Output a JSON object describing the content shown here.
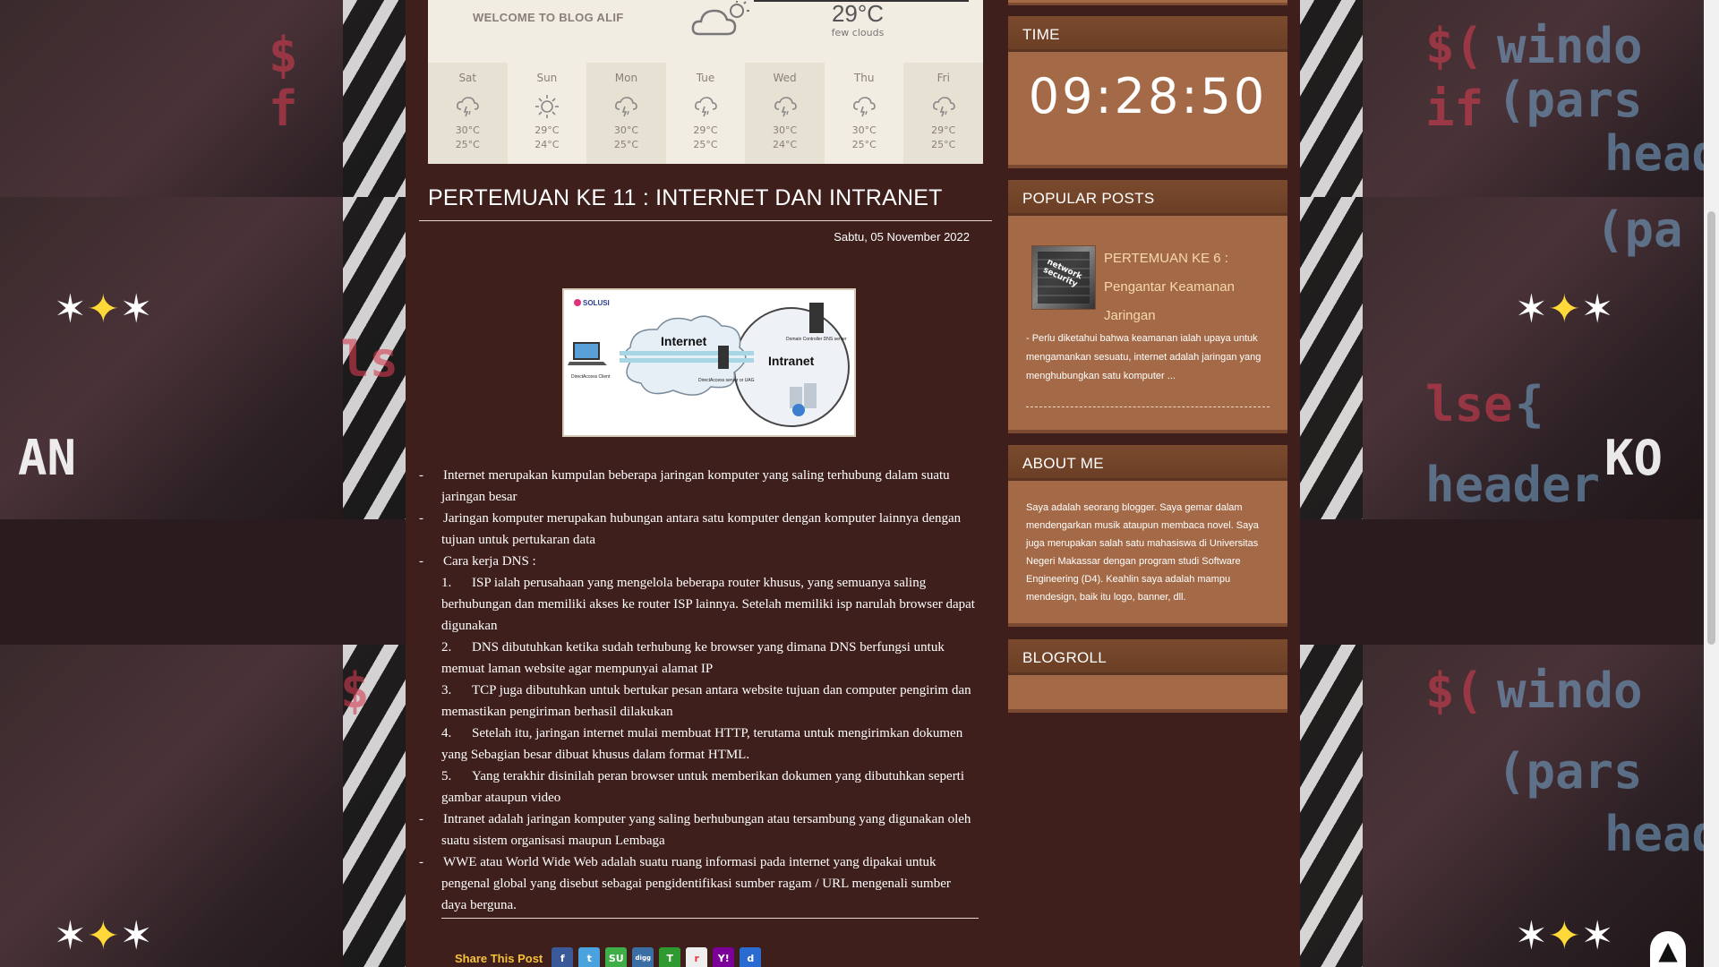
{
  "weather": {
    "welcome": "WELCOME TO BLOG ALIF",
    "current_temp": "29°C",
    "current_condition": "few clouds",
    "days": [
      {
        "name": "Sat",
        "icon": "rain-cloud-icon",
        "hi": "30°C",
        "lo": "25°C"
      },
      {
        "name": "Sun",
        "icon": "sun-icon",
        "hi": "29°C",
        "lo": "24°C"
      },
      {
        "name": "Mon",
        "icon": "rain-cloud-icon",
        "hi": "30°C",
        "lo": "25°C"
      },
      {
        "name": "Tue",
        "icon": "rain-cloud-icon",
        "hi": "29°C",
        "lo": "25°C"
      },
      {
        "name": "Wed",
        "icon": "rain-cloud-icon",
        "hi": "30°C",
        "lo": "24°C"
      },
      {
        "name": "Thu",
        "icon": "rain-cloud-icon",
        "hi": "30°C",
        "lo": "25°C"
      },
      {
        "name": "Fri",
        "icon": "rain-cloud-icon",
        "hi": "29°C",
        "lo": "25°C"
      }
    ]
  },
  "post": {
    "title": "PERTEMUAN KE 11 : INTERNET DAN INTRANET",
    "date": "Sabtu, 05 November 2022",
    "image_labels": {
      "brand": "SOLUSI",
      "internet": "Internet",
      "intranet": "Intranet",
      "client": "DirectAccess Client",
      "server": "DirectAccess server or UAG",
      "dc": "Domain Controller DNS server"
    },
    "bullet_1": "Internet merupakan kumpulan beberapa jaringan komputer  yang saling terhubung dalam suatu jaringan besar",
    "bullet_2": "Jaringan komputer merupakan hubungan antara satu komputer dengan komputer lainnya dengan tujuan untuk pertukaran data",
    "bullet_3": "Cara kerja DNS :",
    "steps": [
      {
        "num": "1.",
        "text": "ISP ialah perusahaan yang mengelola beberapa router khusus, yang semuanya saling berhubungan dan memiliki akses ke router ISP lainnya. Setelah memiliki isp narulah browser dapat digunakan"
      },
      {
        "num": "2.",
        "text": "DNS dibutuhkan ketika sudah terhubung ke browser yang dimana DNS berfungsi untuk memuat laman website agar mempunyai alamat IP"
      },
      {
        "num": "3.",
        "text": "TCP juga dibutuhkan untuk bertukar pesan antara website tujuan dan computer pengirim dan memastikan pengiriman berhasil dilakukan"
      },
      {
        "num": "4.",
        "text": "Setelah itu, jaringan internet mulai membuat  HTTP, terutama untuk mengirimkan dokumen yang Sebagian besar dibuat khusus dalam format HTML."
      },
      {
        "num": "5.",
        "text": "Yang terakhir disinilah peran browser untuk memberikan dokumen yang dibutuhkan seperti gambar ataupun video"
      }
    ],
    "bullet_4": "Intranet adalah jaringan komputer yang saling berhubungan atau tersambung yang digunakan oleh suatu sistem organisasi maupun Lembaga",
    "bullet_5": "WWE atau World Wide Web adalah suatu ruang informasi pada internet yang dipakai untuk pengenal global yang disebut sebagai pengidentifikasi sumber ragam / URL mengenali sumber daya berguna.",
    "dash": "-",
    "share_label": "Share This Post"
  },
  "share_buttons": [
    {
      "icon": "facebook-icon",
      "glyph": "f",
      "color": "#3b5998"
    },
    {
      "icon": "twitter-icon",
      "glyph": "t",
      "color": "#4aa3df"
    },
    {
      "icon": "stumbleupon-icon",
      "glyph": "SU",
      "color": "#3fae49"
    },
    {
      "icon": "digg-icon",
      "glyph": "digg",
      "color": "#3a6ea5"
    },
    {
      "icon": "technorati-icon",
      "glyph": "T",
      "color": "#2f9a2f"
    },
    {
      "icon": "reddit-icon",
      "glyph": "r",
      "color": "#eeeeee"
    },
    {
      "icon": "yahoo-icon",
      "glyph": "Y!",
      "color": "#7b0099"
    },
    {
      "icon": "delicious-icon",
      "glyph": "d",
      "color": "#2a6bd1"
    }
  ],
  "sidebar": {
    "time_title": "TIME",
    "time": "09:28:50",
    "popular_title": "POPULAR POSTS",
    "popular": {
      "title": "PERTEMUAN KE 6 : Pengantar Keamanan Jaringan",
      "thumb_text": "network security",
      "snippet": "-        Perlu diketahui bahwa keamanan ialah upaya untuk mengamankan sesuatu, internet adalah jaringan yang menghubungkan satu komputer ..."
    },
    "about_title": "ABOUT ME",
    "about_text": "Saya adalah seorang blogger. Saya gemar dalam mendengarkan musik ataupun membaca novel. Saya juga merupakan salah satu mahasiswa di Universitas Negeri Makassar dengan program studi Software Engineering (D4). Keahlin saya adalah mampu mendesign, baik itu logo, banner, dll.",
    "blogroll_title": "BLOGROLL"
  },
  "scroll_top_glyph": "▲"
}
